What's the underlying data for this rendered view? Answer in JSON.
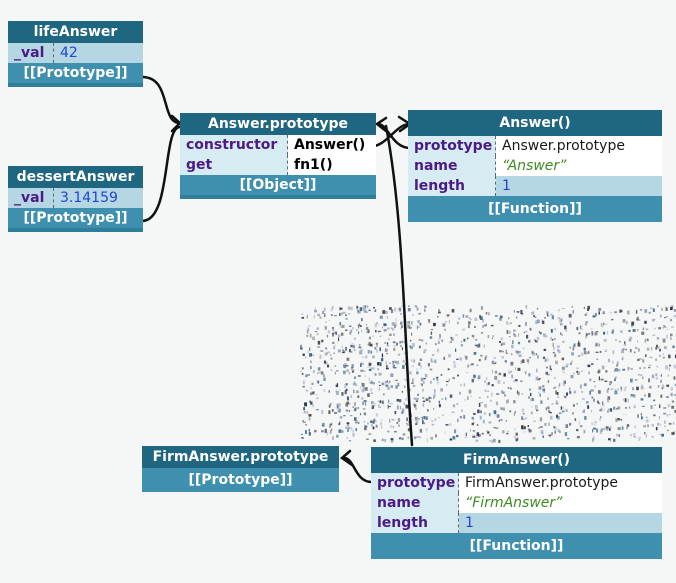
{
  "lifeAnswer": {
    "title": "lifeAnswer",
    "key": "_val",
    "value": "42",
    "footer": "[[Prototype]]"
  },
  "dessertAnswer": {
    "title": "dessertAnswer",
    "key": "_val",
    "value": "3.14159",
    "footer": "[[Prototype]]"
  },
  "answerPrototype": {
    "title": "Answer.prototype",
    "rows": [
      {
        "key": "constructor",
        "value": "Answer()"
      },
      {
        "key": "get",
        "value": "fn1()"
      }
    ],
    "footer": "[[Object]]"
  },
  "answerFn": {
    "title": "Answer()",
    "rows": [
      {
        "key": "prototype",
        "value": "Answer.prototype"
      },
      {
        "key": "name",
        "value": "“Answer”"
      },
      {
        "key": "length",
        "value": "1"
      }
    ],
    "footer": "[[Function]]"
  },
  "firmAnswerPrototype": {
    "title": "FirmAnswer.prototype",
    "footer": "[[Prototype]]"
  },
  "firmAnswerFn": {
    "title": "FirmAnswer()",
    "rows": [
      {
        "key": "prototype",
        "value": "FirmAnswer.prototype"
      },
      {
        "key": "name",
        "value": "“FirmAnswer”"
      },
      {
        "key": "length",
        "value": "1"
      }
    ],
    "footer": "[[Function]]"
  },
  "colors": {
    "header": "#1f6681",
    "body": "#2f7f9b",
    "key": "#4b1a86",
    "number": "#2443d6",
    "string": "#3f8a22",
    "line": "#111111"
  }
}
